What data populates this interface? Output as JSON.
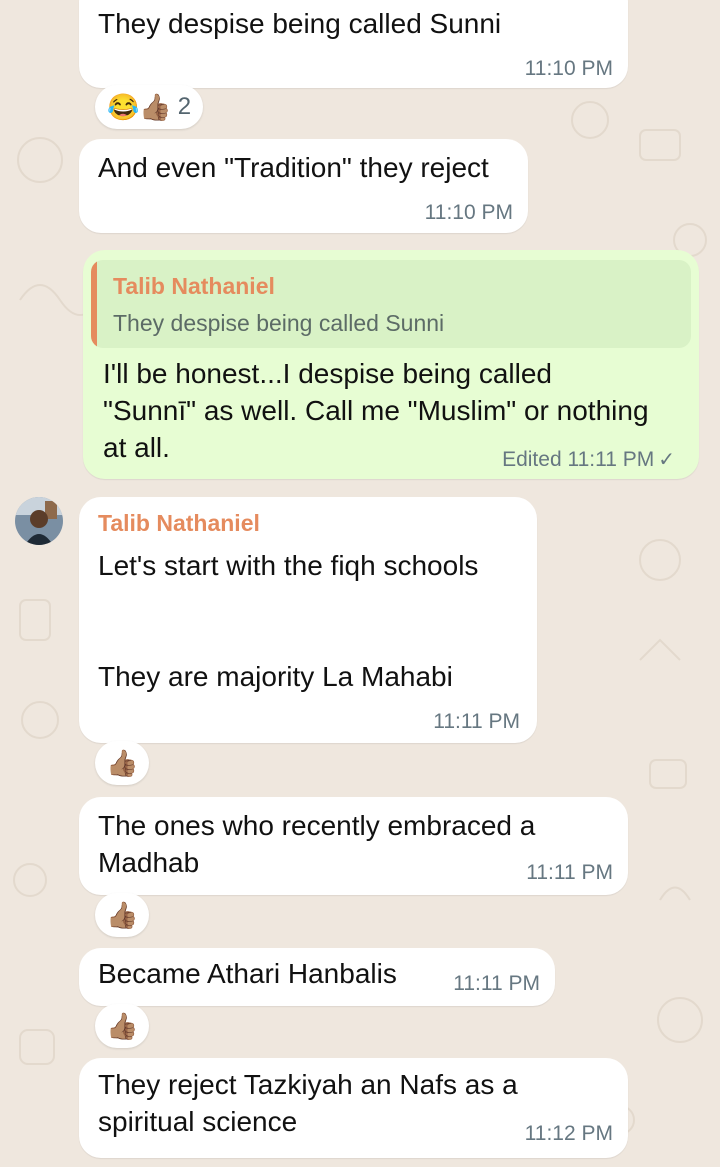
{
  "messages": [
    {
      "text": "They despise being called Sunni",
      "time": "11:10 PM"
    },
    {
      "text": "And even \"Tradition\" they reject",
      "time": "11:10 PM"
    },
    {
      "quote_sender": "Talib Nathaniel",
      "quote_text": "They despise being called Sunni",
      "lines": [
        "I'll be honest...I despise being called",
        "\"Sunnī\" as well. Call me \"Muslim\" or nothing",
        "at all."
      ],
      "status": "Edited 11:11 PM"
    },
    {
      "sender": "Talib Nathaniel",
      "line1": "Let's start with the fiqh schools",
      "line2": "They are majority La Mahabi",
      "time": "11:11 PM"
    },
    {
      "lines": [
        "The ones who recently embraced a",
        "Madhab"
      ],
      "time": "11:11 PM"
    },
    {
      "text": "Became Athari Hanbalis",
      "time": "11:11 PM"
    },
    {
      "lines": [
        "They reject Tazkiyah an Nafs as a",
        "spiritual science"
      ],
      "time": "11:12 PM"
    }
  ],
  "reactions": {
    "first": {
      "emojis": "😂👍🏽",
      "count": "2"
    },
    "thumbs": "👍🏽"
  },
  "icons": {
    "read_tick": "check-icon"
  },
  "colors": {
    "incoming_bubble": "#ffffff",
    "outgoing_bubble": "#e7fdd3",
    "sender_name": "#e58b5e",
    "timestamp": "#667781"
  }
}
